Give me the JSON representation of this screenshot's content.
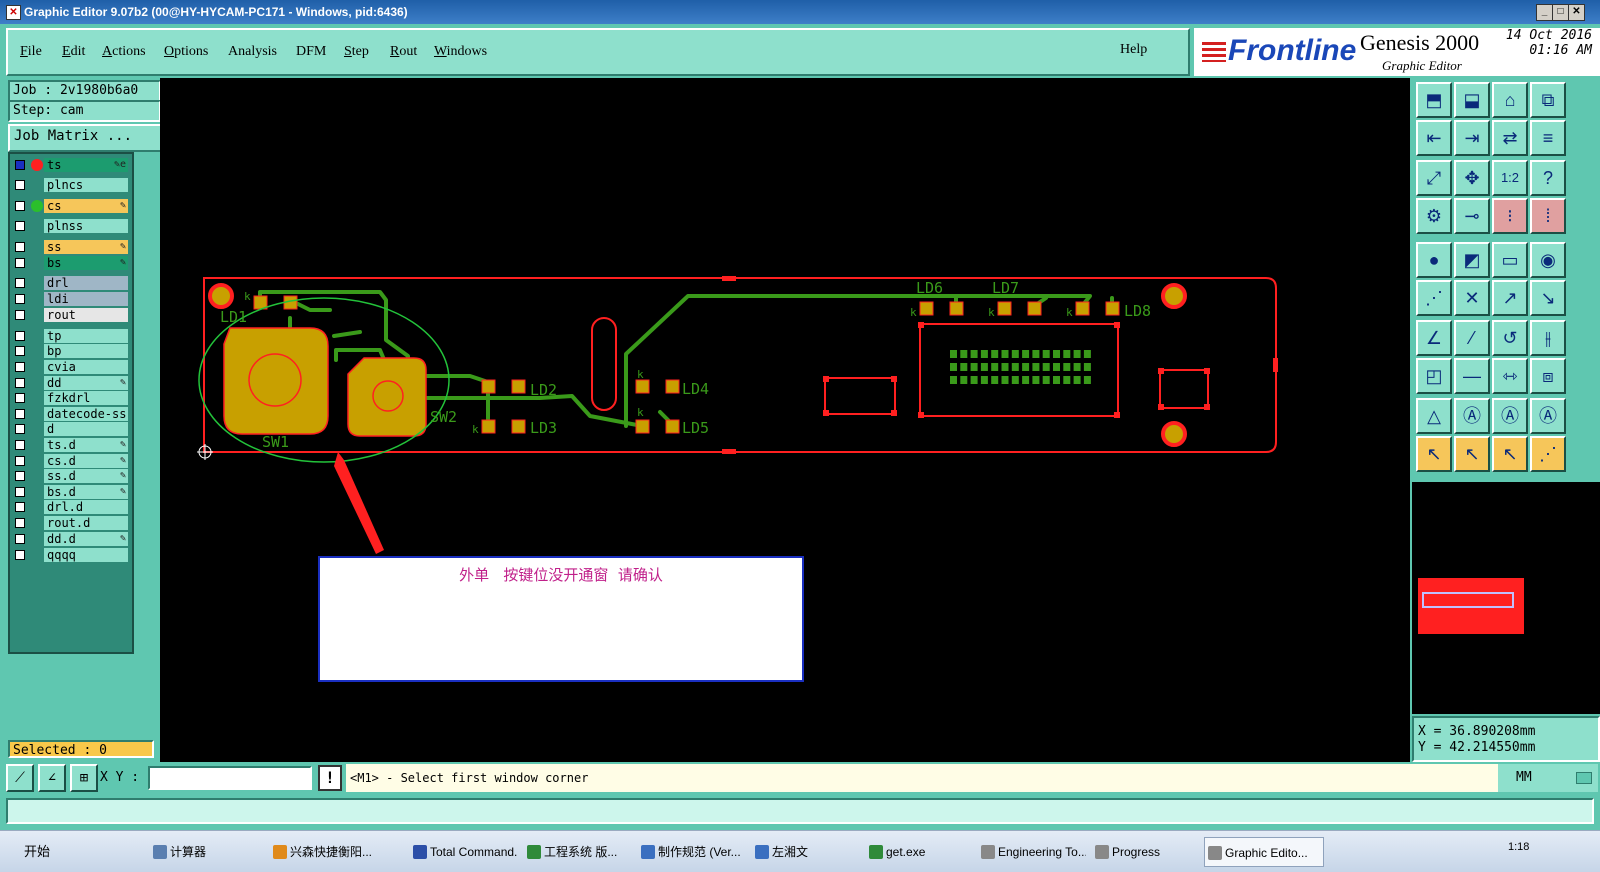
{
  "window": {
    "title": "Graphic Editor 9.07b2 (00@HY-HYCAM-PC171 - Windows, pid:6436)"
  },
  "menu": [
    {
      "key": "F",
      "rest": "ile"
    },
    {
      "key": "E",
      "rest": "dit"
    },
    {
      "key": "A",
      "rest": "ctions"
    },
    {
      "key": "O",
      "rest": "ptions"
    },
    {
      "key": "",
      "rest": "Analysis"
    },
    {
      "key": "",
      "rest": "DFM"
    },
    {
      "key": "S",
      "rest": "tep"
    },
    {
      "key": "R",
      "rest": "out"
    },
    {
      "key": "W",
      "rest": "indows"
    }
  ],
  "help_label": "Help",
  "brand": {
    "frontline": "Frontline",
    "product": "Genesis 2000",
    "subtitle": "Graphic Editor",
    "date": "14 Oct 2016",
    "time": "01:16 AM"
  },
  "job": {
    "job_line": "Job : 2v1980b6a0",
    "step_line": "Step: cam",
    "matrix_label": "Job Matrix ..."
  },
  "layers": [
    {
      "name": "ts",
      "color": "#1c9c6f",
      "dot": "#ff2020",
      "flag": "✎e",
      "active": true
    },
    {
      "name": "plncs",
      "color": "#8ee0cc",
      "dot": "",
      "flag": ""
    },
    {
      "name": "cs",
      "color": "#f6c65a",
      "dot": "#2bbf2b",
      "flag": "✎"
    },
    {
      "name": "plnss",
      "color": "#8ee0cc",
      "dot": "",
      "flag": ""
    },
    {
      "name": "ss",
      "color": "#f6c65a",
      "dot": "",
      "flag": "✎"
    },
    {
      "name": "bs",
      "color": "#1c9c6f",
      "dot": "",
      "flag": "✎"
    },
    {
      "name": "drl",
      "color": "#9fb6c6",
      "dot": "",
      "flag": ""
    },
    {
      "name": "ldi",
      "color": "#9fb6c6",
      "dot": "",
      "flag": ""
    },
    {
      "name": "rout",
      "color": "#e6e6e6",
      "dot": "",
      "flag": ""
    },
    {
      "name": "tp",
      "color": "#8ee0cc",
      "dot": "",
      "flag": ""
    },
    {
      "name": "bp",
      "color": "#8ee0cc",
      "dot": "",
      "flag": ""
    },
    {
      "name": "cvia",
      "color": "#8ee0cc",
      "dot": "",
      "flag": ""
    },
    {
      "name": "dd",
      "color": "#8ee0cc",
      "dot": "",
      "flag": "✎"
    },
    {
      "name": "fzkdrl",
      "color": "#8ee0cc",
      "dot": "",
      "flag": ""
    },
    {
      "name": "datecode-ss",
      "color": "#8ee0cc",
      "dot": "",
      "flag": ""
    },
    {
      "name": "d",
      "color": "#8ee0cc",
      "dot": "",
      "flag": ""
    },
    {
      "name": "ts.d",
      "color": "#8ee0cc",
      "dot": "",
      "flag": "✎"
    },
    {
      "name": "cs.d",
      "color": "#8ee0cc",
      "dot": "",
      "flag": "✎"
    },
    {
      "name": "ss.d",
      "color": "#8ee0cc",
      "dot": "",
      "flag": "✎"
    },
    {
      "name": "bs.d",
      "color": "#8ee0cc",
      "dot": "",
      "flag": "✎"
    },
    {
      "name": "drl.d",
      "color": "#8ee0cc",
      "dot": "",
      "flag": ""
    },
    {
      "name": "rout.d",
      "color": "#8ee0cc",
      "dot": "",
      "flag": ""
    },
    {
      "name": "dd.d",
      "color": "#8ee0cc",
      "dot": "",
      "flag": "✎"
    },
    {
      "name": "qqqq",
      "color": "#8ee0cc",
      "dot": "",
      "flag": ""
    }
  ],
  "selected_label": "Selected : 0",
  "board": {
    "labels": {
      "ld1": "LD1",
      "ld2": "LD2",
      "ld3": "LD3",
      "ld4": "LD4",
      "ld5": "LD5",
      "ld6": "LD6",
      "ld7": "LD7",
      "ld8": "LD8",
      "sw1": "SW1",
      "sw2": "SW2",
      "k": "k"
    },
    "annotation": "外单   按键位没开通窗  请确认",
    "colors": {
      "outline": "#ff2020",
      "copper": "#c8a000",
      "trace": "#3a9a1a",
      "ellipse": "#23c23a"
    }
  },
  "coords": {
    "x": "X = 36.890208mm",
    "y": "Y = 42.214550mm"
  },
  "status": {
    "xy_label": "X Y :",
    "xy_value": "",
    "prompt": "<M1> - Select first window corner",
    "units": "MM"
  },
  "taskbar": {
    "start": "开始",
    "tasks": [
      {
        "label": "计算器",
        "icon": "#5a7fb0"
      },
      {
        "label": "兴森快捷衡阳...",
        "icon": "#e08a1a"
      },
      {
        "label": "Total Command...",
        "icon": "#2c4fa8"
      },
      {
        "label": "工程系统   版...",
        "icon": "#2f8a3a"
      },
      {
        "label": "制作规范 (Ver...",
        "icon": "#3a6fc0"
      },
      {
        "label": "左湘文",
        "icon": "#3a6fc0"
      },
      {
        "label": "get.exe",
        "icon": "#2f8a3a"
      },
      {
        "label": "Engineering To...",
        "icon": "#888888"
      },
      {
        "label": "Progress",
        "icon": "#888888"
      },
      {
        "label": "Graphic Edito...",
        "icon": "#888888",
        "active": true
      }
    ],
    "clock": "1:18"
  }
}
